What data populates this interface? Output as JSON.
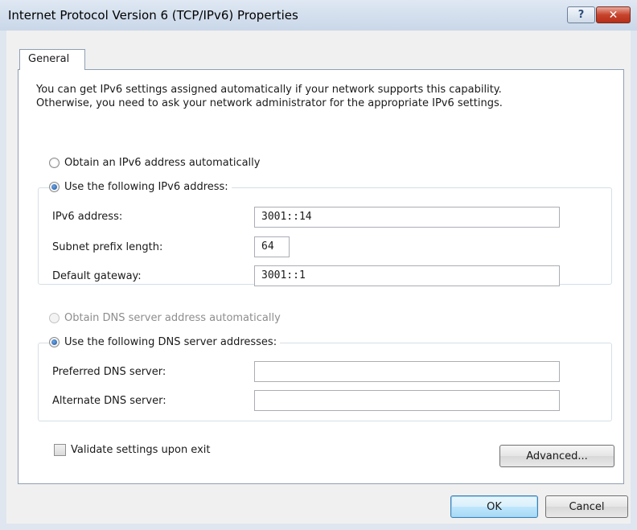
{
  "window": {
    "title": "Internet Protocol Version 6 (TCP/IPv6) Properties",
    "help_label": "?",
    "close_label": "✕"
  },
  "tabs": [
    {
      "label": "General",
      "selected": true
    }
  ],
  "description": {
    "line1": "You can get IPv6 settings assigned automatically if your network supports this capability.",
    "line2": "Otherwise, you need to ask your network administrator for the appropriate IPv6 settings."
  },
  "ip_section": {
    "auto_label": "Obtain an IPv6 address automatically",
    "auto_selected": false,
    "manual_label": "Use the following IPv6 address:",
    "manual_selected": true,
    "fields": [
      {
        "label": "IPv6 address:",
        "value": "3001::14"
      },
      {
        "label": "Subnet prefix length:",
        "value": "64"
      },
      {
        "label": "Default gateway:",
        "value": "3001::1"
      }
    ]
  },
  "dns_section": {
    "auto_label": "Obtain DNS server address automatically",
    "auto_selected": false,
    "auto_disabled": true,
    "manual_label": "Use the following DNS server addresses:",
    "manual_selected": true,
    "fields": [
      {
        "label": "Preferred DNS server:",
        "value": ""
      },
      {
        "label": "Alternate DNS server:",
        "value": ""
      }
    ]
  },
  "validate": {
    "label": "Validate settings upon exit",
    "checked": false
  },
  "buttons": {
    "advanced": "Advanced...",
    "ok": "OK",
    "cancel": "Cancel"
  },
  "colors": {
    "title_bar": "#c9d7e8",
    "close_button": "#c7432c",
    "default_button_border": "#3c7fb1"
  }
}
